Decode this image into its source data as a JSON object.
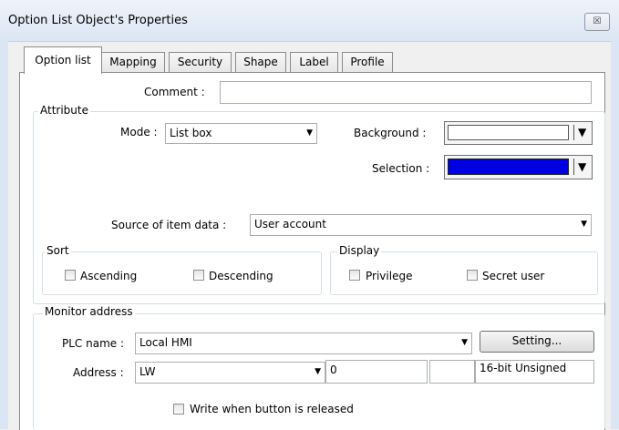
{
  "window": {
    "title": "Option List Object's Properties",
    "close_glyph": "☒"
  },
  "tabs": [
    {
      "label": "Option list"
    },
    {
      "label": "Mapping"
    },
    {
      "label": "Security"
    },
    {
      "label": "Shape"
    },
    {
      "label": "Label"
    },
    {
      "label": "Profile"
    }
  ],
  "comment": {
    "label": "Comment :",
    "value": ""
  },
  "attribute": {
    "legend": "Attribute",
    "mode_label": "Mode :",
    "mode_value": "List box",
    "background_label": "Background :",
    "background_color": "#ffffff",
    "selection_label": "Selection :",
    "selection_color": "#0000e0",
    "source_label": "Source of item data :",
    "source_value": "User account"
  },
  "sort": {
    "legend": "Sort",
    "ascending": "Ascending",
    "descending": "Descending"
  },
  "display": {
    "legend": "Display",
    "privilege": "Privilege",
    "secret_user": "Secret user"
  },
  "monitor": {
    "legend": "Monitor address",
    "plc_label": "PLC name :",
    "plc_value": "Local HMI",
    "setting_button": "Setting...",
    "address_label": "Address :",
    "address_type": "LW",
    "address_value": "0",
    "address_extra": "",
    "data_format": "16-bit Unsigned",
    "write_on_release": "Write when button is released"
  }
}
